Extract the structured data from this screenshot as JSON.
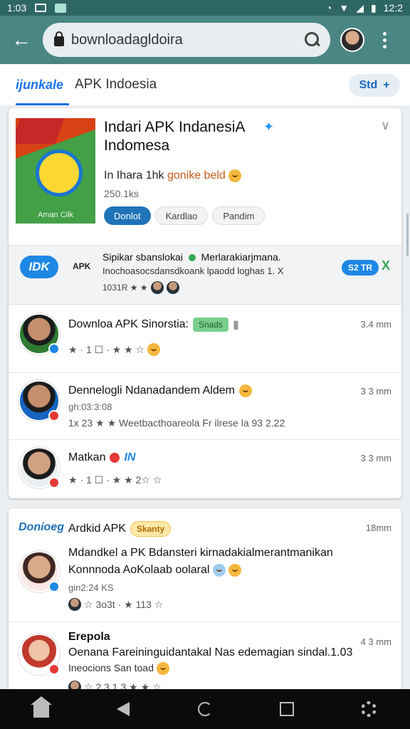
{
  "statusbar": {
    "time_left": "1:03",
    "time_right": "12:2"
  },
  "toolbar": {
    "url": "bownloadagldoira",
    "back_icon": "arrow-left-icon"
  },
  "tabs": {
    "active": "ijunkale",
    "title": "APK Indoesia",
    "pill": "Std"
  },
  "hero": {
    "title": "Indari APK IndanesiA Indomesa",
    "image_label": "Aman Cilk",
    "line_prefix": "In Ihara 1hk",
    "line_accent": "gonike beld",
    "size": "250.1ks",
    "buttons": [
      "Donlot",
      "Kardlao",
      "Pandim"
    ]
  },
  "promo": {
    "logo": "IDK",
    "tag": "APK",
    "title_a": "Sipikar sbanslokai",
    "title_b": "Merlarakiarjmana.",
    "subtitle": "Inochoasocsdansdkoank lpaodd loghas 1. X",
    "meta": "1031R ★ ★",
    "pill": "S2 TR",
    "close": "X"
  },
  "list": [
    {
      "title": "Downloa APK Sinorstia:",
      "chip": "Snads",
      "meta": "★ · 1 ☐ · ★ ★ ☆",
      "time": "3.4 mm"
    },
    {
      "title": "Dennelogli  Ndanadandem Aldem",
      "sub": "gh:03:3:08",
      "meta": "1x   23 ★ ★   Weetbacthoareola Fr ilrese la 93 2.22",
      "time": "3 3 mm"
    },
    {
      "title": "Matkan",
      "mark": "IN",
      "meta": "★ · 1 ☐ · ★ ★ 2☆ ☆",
      "time": "3 3 mm"
    }
  ],
  "card2": {
    "brand": "Donioeg",
    "title": "Ardkid APK",
    "chip": "Skanty",
    "time": "18mm",
    "items": [
      {
        "line1": "Mdandkel a PK Bdansteri kirnadakialmerantmanikan",
        "line2": "Konnnoda AoKolaab oolaral",
        "sub": "gin2:24 KS",
        "meta": "☆   3o3t · ★ 113 ☆"
      },
      {
        "name": "Erepola",
        "line1": "Oenana Fareininguidantakal Nas edemagian sindal.1.03",
        "line2": "Ineocions San toad",
        "meta": "☆   2 3 1 3 ★ ★   ☆",
        "time": "4 3 mm"
      }
    ]
  },
  "nav": [
    "home-icon",
    "back-triangle-icon",
    "recents-icon",
    "overview-square-icon",
    "settings-gear-icon"
  ]
}
